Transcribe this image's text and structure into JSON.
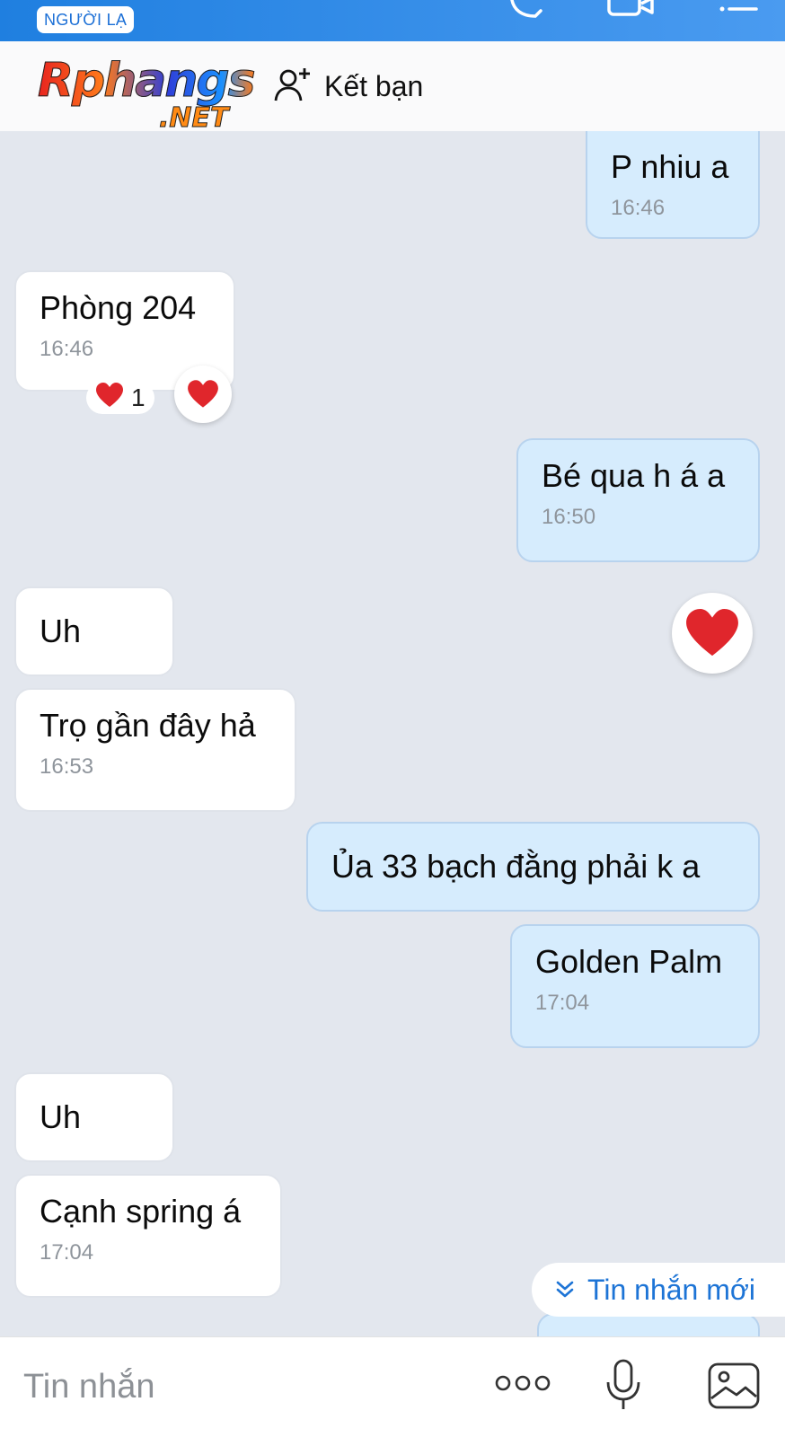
{
  "status_bar": {
    "stranger_badge": "NGƯỜI LẠ",
    "icons": [
      "phone-icon",
      "video-call-icon",
      "menu-icon"
    ]
  },
  "header": {
    "logo_main": "Rphangs",
    "logo_suffix": ".NET",
    "add_friend_label": "Kết bạn",
    "add_friend_icon": "add-user-icon"
  },
  "messages": [
    {
      "direction": "out",
      "text": "P nhiu a",
      "time": "16:46"
    },
    {
      "direction": "in",
      "text": "Phòng 204",
      "time": "16:46",
      "reaction": {
        "emoji": "❤️",
        "count": "1"
      }
    },
    {
      "direction": "out",
      "text": "Bé qua h á a",
      "time": "16:50"
    },
    {
      "direction": "in",
      "text": "Uh"
    },
    {
      "direction": "in",
      "text": "Trọ gần đây hả",
      "time": "16:53"
    },
    {
      "direction": "out",
      "text": "Ủa 33 bạch đằng phải k a"
    },
    {
      "direction": "out",
      "text": "Golden Palm",
      "time": "17:04"
    },
    {
      "direction": "in",
      "text": "Uh"
    },
    {
      "direction": "in",
      "text": "Cạnh spring á",
      "time": "17:04"
    }
  ],
  "new_messages_label": "Tin nhắn mới",
  "composer": {
    "placeholder": "Tin nhắn",
    "icons": [
      "more-options-icon",
      "microphone-icon",
      "image-icon"
    ]
  },
  "colors": {
    "top_bar": "#2f8ae8",
    "chat_background": "#e3e7ee",
    "outgoing_bubble": "#d6ecfd",
    "incoming_bubble": "#ffffff",
    "accent": "#1d74d6",
    "heart": "#e0262c"
  }
}
